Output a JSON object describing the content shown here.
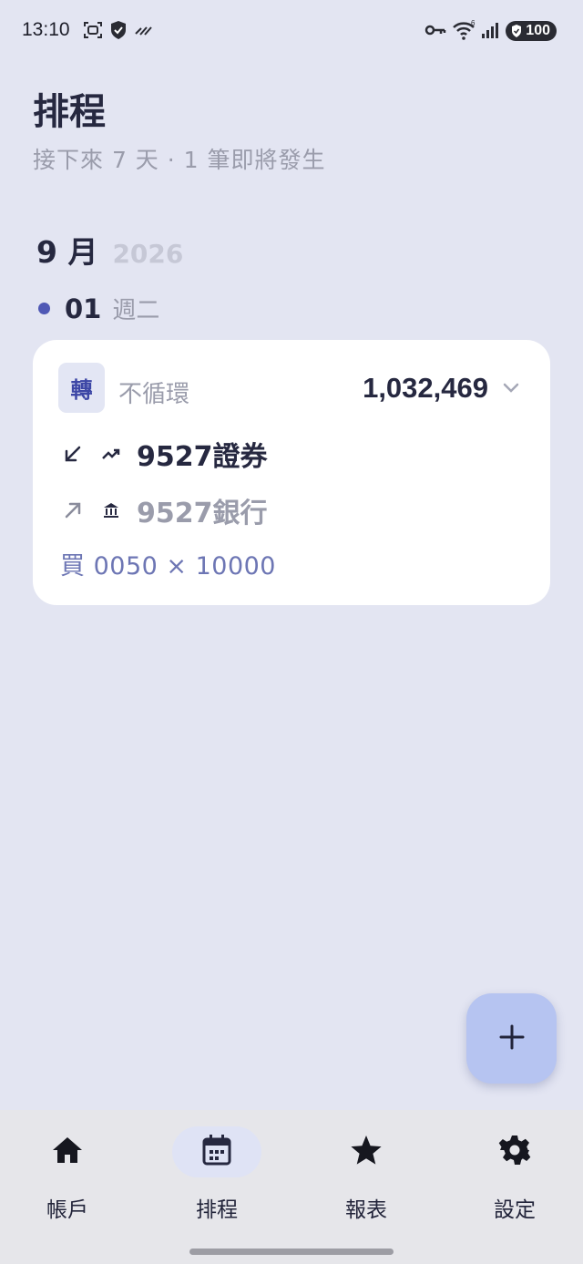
{
  "status_bar": {
    "time": "13:10",
    "battery": "100",
    "icons": [
      "screenshot-icon",
      "shield-icon",
      "signal-stripes-icon",
      "vpn-key-icon",
      "wifi-icon",
      "cell-signal-icon",
      "battery-icon"
    ]
  },
  "header": {
    "title": "排程",
    "subtitle": "接下來 7 天 · 1 筆即將發生"
  },
  "schedule": {
    "month": "9 月",
    "year": "2026",
    "day": "01",
    "weekday": "週二",
    "items": [
      {
        "type_badge": "轉",
        "recurrence": "不循環",
        "amount": "1,032,469",
        "to_account": "9527證券",
        "from_account": "9527銀行",
        "note": "買 0050 × 10000"
      }
    ]
  },
  "fab": {
    "icon": "plus-icon"
  },
  "nav": {
    "items": [
      {
        "label": "帳戶",
        "icon": "home-icon",
        "active": false
      },
      {
        "label": "排程",
        "icon": "calendar-icon",
        "active": true
      },
      {
        "label": "報表",
        "icon": "star-icon",
        "active": false
      },
      {
        "label": "設定",
        "icon": "gear-icon",
        "active": false
      }
    ]
  },
  "colors": {
    "background": "#e3e5f2",
    "accent": "#4f58b5",
    "card": "#ffffff",
    "fab": "#b6c4f1"
  }
}
